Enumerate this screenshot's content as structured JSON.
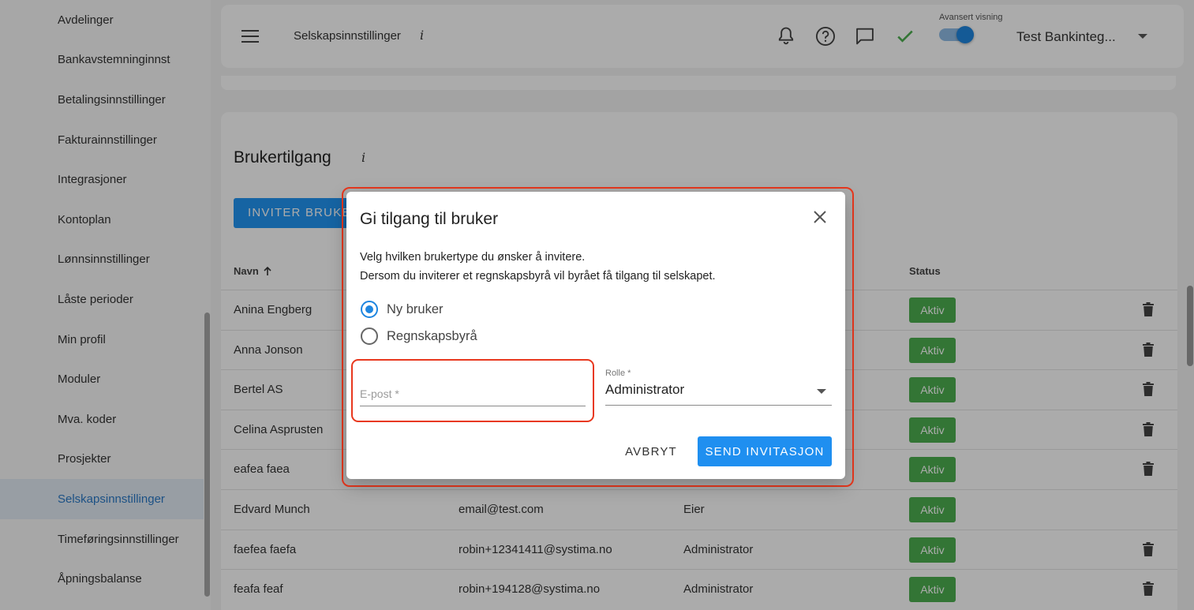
{
  "sidebar": {
    "items": [
      {
        "label": "Avdelinger"
      },
      {
        "label": "Bankavstemninginnst"
      },
      {
        "label": "Betalingsinnstillinger"
      },
      {
        "label": "Fakturainnstillinger"
      },
      {
        "label": "Integrasjoner"
      },
      {
        "label": "Kontoplan"
      },
      {
        "label": "Lønnsinnstillinger"
      },
      {
        "label": "Låste perioder"
      },
      {
        "label": "Min profil"
      },
      {
        "label": "Moduler"
      },
      {
        "label": "Mva. koder"
      },
      {
        "label": "Prosjekter"
      },
      {
        "label": "Selskapsinnstillinger",
        "active": true
      },
      {
        "label": "Timeføringsinnstillinger"
      },
      {
        "label": "Åpningsbalanse"
      }
    ]
  },
  "header": {
    "title": "Selskapsinnstillinger",
    "info": "i",
    "toggle_label": "Avansert visning",
    "toggle_on": true,
    "company": "Test Bankinteg...",
    "icons": [
      "bell-icon",
      "help-icon",
      "chat-icon",
      "check-icon"
    ],
    "accent": "#1f86e0",
    "check_color": "#4caf50"
  },
  "main": {
    "section_title": "Brukertilgang",
    "section_info": "i",
    "invite_label": "INVITER BRUKER",
    "columns": {
      "name": "Navn",
      "status": "Status"
    },
    "rows": [
      {
        "name": "Anina Engberg",
        "email": "",
        "role": "",
        "status": "Aktiv",
        "deletable": true
      },
      {
        "name": "Anna Jonson",
        "email": "",
        "role": "",
        "status": "Aktiv",
        "deletable": true
      },
      {
        "name": "Bertel AS",
        "email": "",
        "role": "",
        "status": "Aktiv",
        "deletable": true
      },
      {
        "name": "Celina Asprusten",
        "email": "",
        "role": "",
        "status": "Aktiv",
        "deletable": true
      },
      {
        "name": "eafea faea",
        "email": "",
        "role": "",
        "status": "Aktiv",
        "deletable": true
      },
      {
        "name": "Edvard Munch",
        "email": "email@test.com",
        "role": "Eier",
        "status": "Aktiv",
        "deletable": false
      },
      {
        "name": "faefea faefa",
        "email": "robin+12341411@systima.no",
        "role": "Administrator",
        "status": "Aktiv",
        "deletable": true
      },
      {
        "name": "feafa feaf",
        "email": "robin+194128@systima.no",
        "role": "Administrator",
        "status": "Aktiv",
        "deletable": true
      }
    ],
    "status_color": "#4caf50"
  },
  "dialog": {
    "title": "Gi tilgang til bruker",
    "desc_line1": "Velg hvilken brukertype du ønsker å invitere.",
    "desc_line2": "Dersom du inviterer et regnskapsbyrå vil byrået få tilgang til selskapet.",
    "options": [
      {
        "label": "Ny bruker",
        "checked": true
      },
      {
        "label": "Regnskapsbyrå",
        "checked": false
      }
    ],
    "email": {
      "placeholder": "E-post *",
      "value": ""
    },
    "role": {
      "label": "Rolle *",
      "value": "Administrator"
    },
    "cancel_label": "AVBRYT",
    "send_label": "SEND INVITASJON",
    "highlight_color": "#e8381e"
  }
}
